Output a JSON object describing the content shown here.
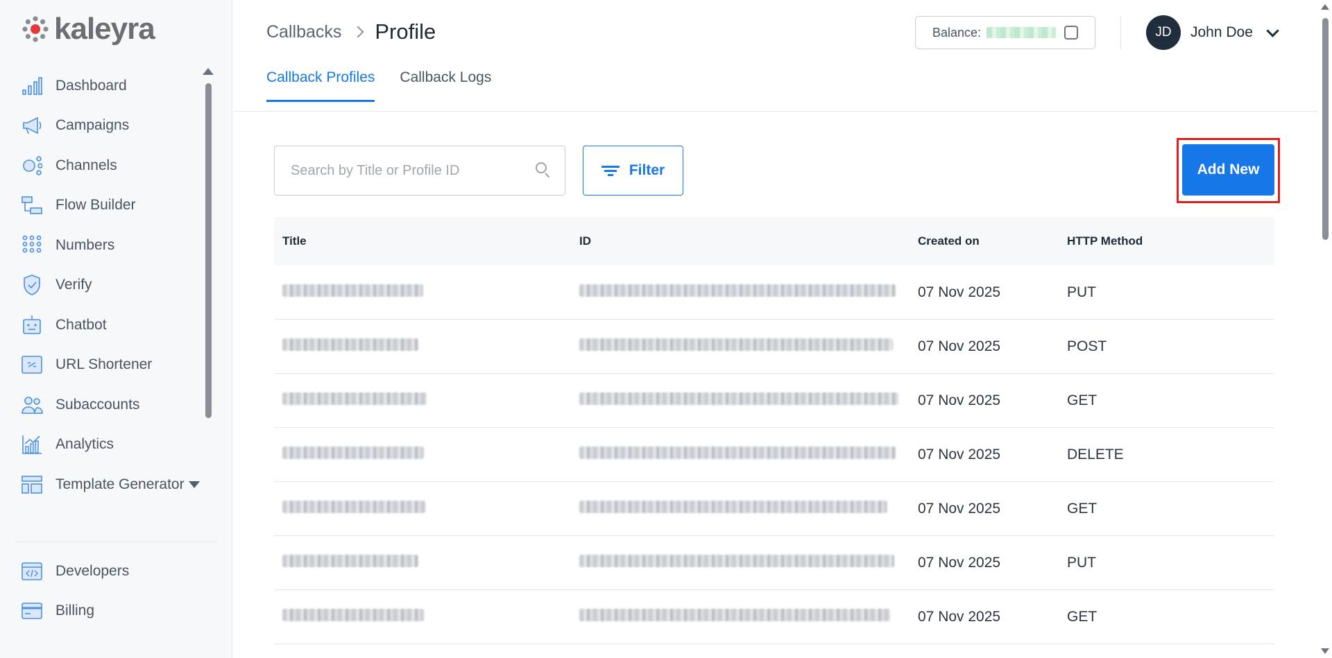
{
  "brand": {
    "name": "kaleyra",
    "accent": "#1677e8",
    "logo_red": "#e53935"
  },
  "sidebar": {
    "items": [
      {
        "label": "Dashboard",
        "icon": "bar-chart-icon"
      },
      {
        "label": "Campaigns",
        "icon": "megaphone-icon"
      },
      {
        "label": "Channels",
        "icon": "channels-icon"
      },
      {
        "label": "Flow Builder",
        "icon": "flow-builder-icon"
      },
      {
        "label": "Numbers",
        "icon": "dialpad-icon"
      },
      {
        "label": "Verify",
        "icon": "shield-check-icon"
      },
      {
        "label": "Chatbot",
        "icon": "chatbot-icon"
      },
      {
        "label": "URL Shortener",
        "icon": "link-icon"
      },
      {
        "label": "Subaccounts",
        "icon": "users-icon"
      },
      {
        "label": "Analytics",
        "icon": "analytics-icon"
      },
      {
        "label": "Template Generator",
        "icon": "template-icon"
      }
    ],
    "bottom_items": [
      {
        "label": "Developers",
        "icon": "code-icon"
      },
      {
        "label": "Billing",
        "icon": "credit-card-icon"
      }
    ]
  },
  "header": {
    "breadcrumb_parent": "Callbacks",
    "breadcrumb_current": "Profile",
    "balance_label": "Balance:",
    "user_initials": "JD",
    "user_name": "John Doe"
  },
  "tabs": [
    {
      "label": "Callback Profiles",
      "active": true
    },
    {
      "label": "Callback Logs",
      "active": false
    }
  ],
  "toolbar": {
    "search_placeholder": "Search by Title or Profile ID",
    "filter_label": "Filter",
    "add_label": "Add New"
  },
  "table": {
    "columns": [
      "Title",
      "ID",
      "Created on",
      "HTTP Method"
    ],
    "rows": [
      {
        "created": "07 Nov 2025",
        "method": "PUT"
      },
      {
        "created": "07 Nov 2025",
        "method": "POST"
      },
      {
        "created": "07 Nov 2025",
        "method": "GET"
      },
      {
        "created": "07 Nov 2025",
        "method": "DELETE"
      },
      {
        "created": "07 Nov 2025",
        "method": "GET"
      },
      {
        "created": "07 Nov 2025",
        "method": "PUT"
      },
      {
        "created": "07 Nov 2025",
        "method": "GET"
      }
    ]
  }
}
